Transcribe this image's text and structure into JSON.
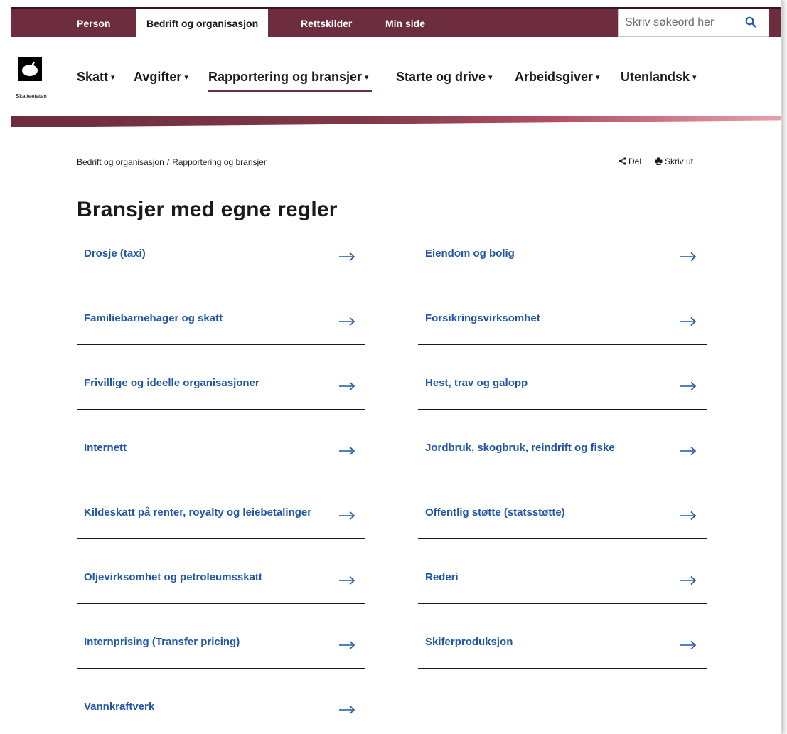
{
  "topbar": {
    "tabs": [
      {
        "label": "Person",
        "active": false
      },
      {
        "label": "Bedrift og organisasjon",
        "active": true
      },
      {
        "label": "Rettskilder",
        "active": false
      },
      {
        "label": "Min side",
        "active": false
      }
    ],
    "search": {
      "placeholder": "Skriv søkeord her",
      "value": ""
    },
    "search_icon": "search-icon"
  },
  "logo": {
    "text": "Skatteetaten",
    "icon": "skatteetaten-logo-icon"
  },
  "nav": {
    "items": [
      {
        "label": "Skatt",
        "active": false
      },
      {
        "label": "Avgifter",
        "active": false
      },
      {
        "label": "Rapportering og bransjer",
        "active": true
      },
      {
        "label": "Starte og drive",
        "active": false
      },
      {
        "label": "Arbeidsgiver",
        "active": false
      },
      {
        "label": "Utenlandsk",
        "active": false
      }
    ],
    "caret": "▾"
  },
  "breadcrumb": {
    "items": [
      "Bedrift og organisasjon",
      "Rapportering og bransjer"
    ],
    "separator": "/"
  },
  "actions": {
    "share_label": "Del",
    "print_label": "Skriv ut"
  },
  "page": {
    "title": "Bransjer med egne regler"
  },
  "links": [
    {
      "label": "Drosje (taxi)"
    },
    {
      "label": "Eiendom og bolig"
    },
    {
      "label": "Familiebarnehager og skatt"
    },
    {
      "label": "Forsikringsvirksomhet"
    },
    {
      "label": "Frivillige og ideelle organisasjoner"
    },
    {
      "label": "Hest, trav og galopp"
    },
    {
      "label": "Internett"
    },
    {
      "label": "Jordbruk, skogbruk, reindrift og fiske"
    },
    {
      "label": "Kildeskatt på renter, royalty og leiebetalinger"
    },
    {
      "label": "Offentlig støtte (statsstøtte)"
    },
    {
      "label": "Oljevirksomhet og petroleumsskatt"
    },
    {
      "label": "Rederi"
    },
    {
      "label": "Internprising (Transfer pricing)"
    },
    {
      "label": "Skiferproduksjon"
    },
    {
      "label": "Vannkraftverk"
    }
  ],
  "colors": {
    "brand": "#6d2d3f",
    "link": "#1f57a4",
    "text": "#1a1a1a"
  }
}
